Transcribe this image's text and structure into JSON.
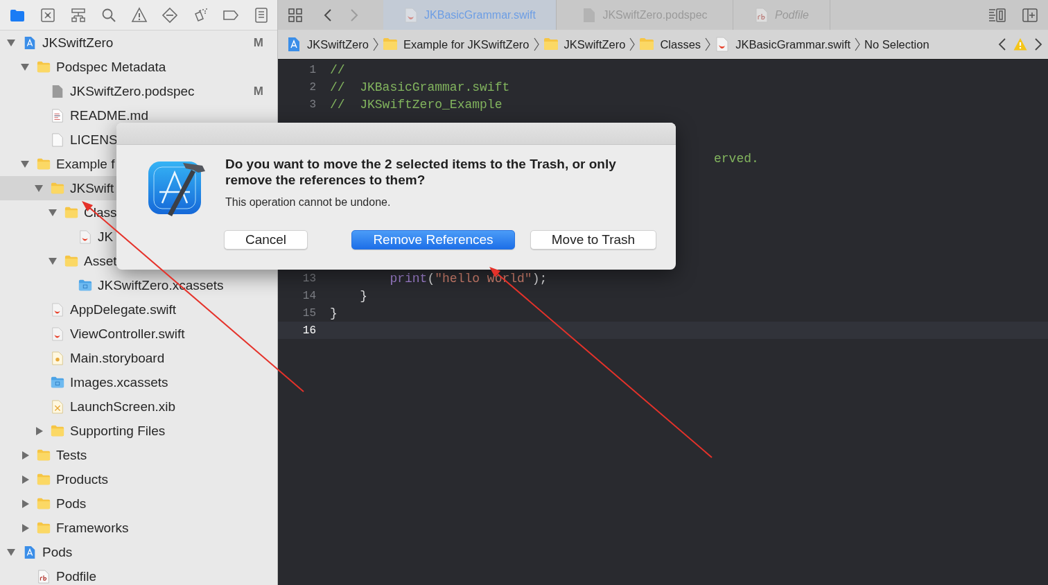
{
  "navigator": {
    "toolbar": [
      {
        "kind": "folder",
        "selected": true
      },
      {
        "kind": "source-control",
        "selected": false
      },
      {
        "kind": "hierarchy",
        "selected": false
      },
      {
        "kind": "search",
        "selected": false
      },
      {
        "kind": "warning",
        "selected": false
      },
      {
        "kind": "test",
        "selected": false
      },
      {
        "kind": "debug",
        "selected": false
      },
      {
        "kind": "breakpoint",
        "selected": false
      },
      {
        "kind": "report",
        "selected": false
      }
    ],
    "tree": [
      {
        "label": "JKSwiftZero",
        "kind": "project",
        "status": "M",
        "expanded": true,
        "selected": false,
        "children": [
          {
            "label": "Podspec Metadata",
            "kind": "folder",
            "expanded": true,
            "selected": false,
            "children": [
              {
                "label": "JKSwiftZero.podspec",
                "kind": "doc",
                "status": "M",
                "selected": false
              },
              {
                "label": "README.md",
                "kind": "text",
                "selected": false
              },
              {
                "label": "LICENS",
                "kind": "blank",
                "selected": false
              }
            ]
          },
          {
            "label": "Example f",
            "kind": "folder",
            "expanded": true,
            "selected": false,
            "children": [
              {
                "label": "JKSwift",
                "kind": "folder",
                "expanded": true,
                "selected": true,
                "children": [
                  {
                    "label": "Class",
                    "kind": "folder",
                    "expanded": true,
                    "selected": false,
                    "children": [
                      {
                        "label": "JK",
                        "kind": "swift",
                        "selected": false
                      }
                    ]
                  },
                  {
                    "label": "Asset",
                    "kind": "folder",
                    "expanded": true,
                    "selected": false,
                    "children": [
                      {
                        "label": "JKSwiftZero.xcassets",
                        "kind": "assets",
                        "selected": false
                      }
                    ]
                  }
                ]
              },
              {
                "label": "AppDelegate.swift",
                "kind": "swift",
                "selected": false
              },
              {
                "label": "ViewController.swift",
                "kind": "swift",
                "selected": false
              },
              {
                "label": "Main.storyboard",
                "kind": "storyboard",
                "selected": false
              },
              {
                "label": "Images.xcassets",
                "kind": "assets",
                "selected": false
              },
              {
                "label": "LaunchScreen.xib",
                "kind": "xib",
                "selected": false
              },
              {
                "label": "Supporting Files",
                "kind": "folder",
                "expanded": false,
                "selected": false
              }
            ]
          },
          {
            "label": "Tests",
            "kind": "folder",
            "expanded": false,
            "selected": false
          },
          {
            "label": "Products",
            "kind": "folder",
            "expanded": false,
            "selected": false
          },
          {
            "label": "Pods",
            "kind": "folder",
            "expanded": false,
            "selected": false
          },
          {
            "label": "Frameworks",
            "kind": "folder",
            "expanded": false,
            "selected": false
          }
        ]
      },
      {
        "label": "Pods",
        "kind": "project",
        "expanded": true,
        "selected": false,
        "children": [
          {
            "label": "Podfile",
            "kind": "rb",
            "selected": false
          }
        ]
      }
    ]
  },
  "editor": {
    "nav": [
      {
        "kind": "grid",
        "disabled": false
      },
      {
        "kind": "back",
        "disabled": false
      },
      {
        "kind": "forward",
        "disabled": true
      }
    ],
    "tabs": [
      {
        "label": "JKBasicGrammar.swift",
        "kind": "swift",
        "selected": true,
        "preview": false
      },
      {
        "label": "JKSwiftZero.podspec",
        "kind": "doc",
        "selected": false,
        "preview": false
      },
      {
        "label": "Podfile",
        "kind": "rb",
        "selected": false,
        "preview": true
      }
    ],
    "tools": [
      {
        "kind": "options"
      },
      {
        "kind": "add-editor"
      }
    ],
    "jump_bar": {
      "crumbs": [
        {
          "kind": "project",
          "label": "JKSwiftZero"
        },
        {
          "kind": "folder",
          "label": "Example for JKSwiftZero"
        },
        {
          "kind": "folder",
          "label": "JKSwiftZero"
        },
        {
          "kind": "folder",
          "label": "Classes"
        },
        {
          "kind": "swift",
          "label": "JKBasicGrammar.swift"
        },
        {
          "kind": "none",
          "label": "No Selection"
        }
      ],
      "warning": true
    },
    "code": {
      "top": [
        {
          "number": "1",
          "current": false,
          "tokens": [
            {
              "kind": "comment",
              "text": "//"
            }
          ]
        },
        {
          "number": "2",
          "current": false,
          "tokens": [
            {
              "kind": "comment",
              "text": "//  JKBasicGrammar.swift"
            }
          ]
        },
        {
          "number": "3",
          "current": false,
          "tokens": [
            {
              "kind": "comment",
              "text": "//  JKSwiftZero_Example"
            }
          ]
        }
      ],
      "fragment": {
        "tokens": [
          {
            "kind": "comment",
            "text": "erved."
          }
        ]
      },
      "bottom": [
        {
          "number": "13",
          "current": false,
          "tokens": [
            {
              "kind": "function",
              "text": "        print"
            },
            {
              "kind": "plain",
              "text": "("
            },
            {
              "kind": "string",
              "text": "\"hello world\""
            },
            {
              "kind": "plain",
              "text": ");"
            }
          ]
        },
        {
          "number": "14",
          "current": false,
          "tokens": [
            {
              "kind": "plain",
              "text": "    }"
            }
          ]
        },
        {
          "number": "15",
          "current": false,
          "tokens": [
            {
              "kind": "plain",
              "text": "}"
            }
          ]
        },
        {
          "number": "16",
          "current": true
        }
      ]
    }
  },
  "dialog": {
    "title": "Do you want to move the 2 selected items to the Trash, or only remove the references to them?",
    "message": "This operation cannot be undone.",
    "buttons": [
      {
        "label": "Cancel",
        "default": false
      },
      {
        "label": "Remove References",
        "default": true
      },
      {
        "label": "Move to Trash",
        "default": false
      }
    ]
  },
  "annotations": [
    {
      "kind": "arrow"
    },
    {
      "kind": "arrow"
    }
  ]
}
